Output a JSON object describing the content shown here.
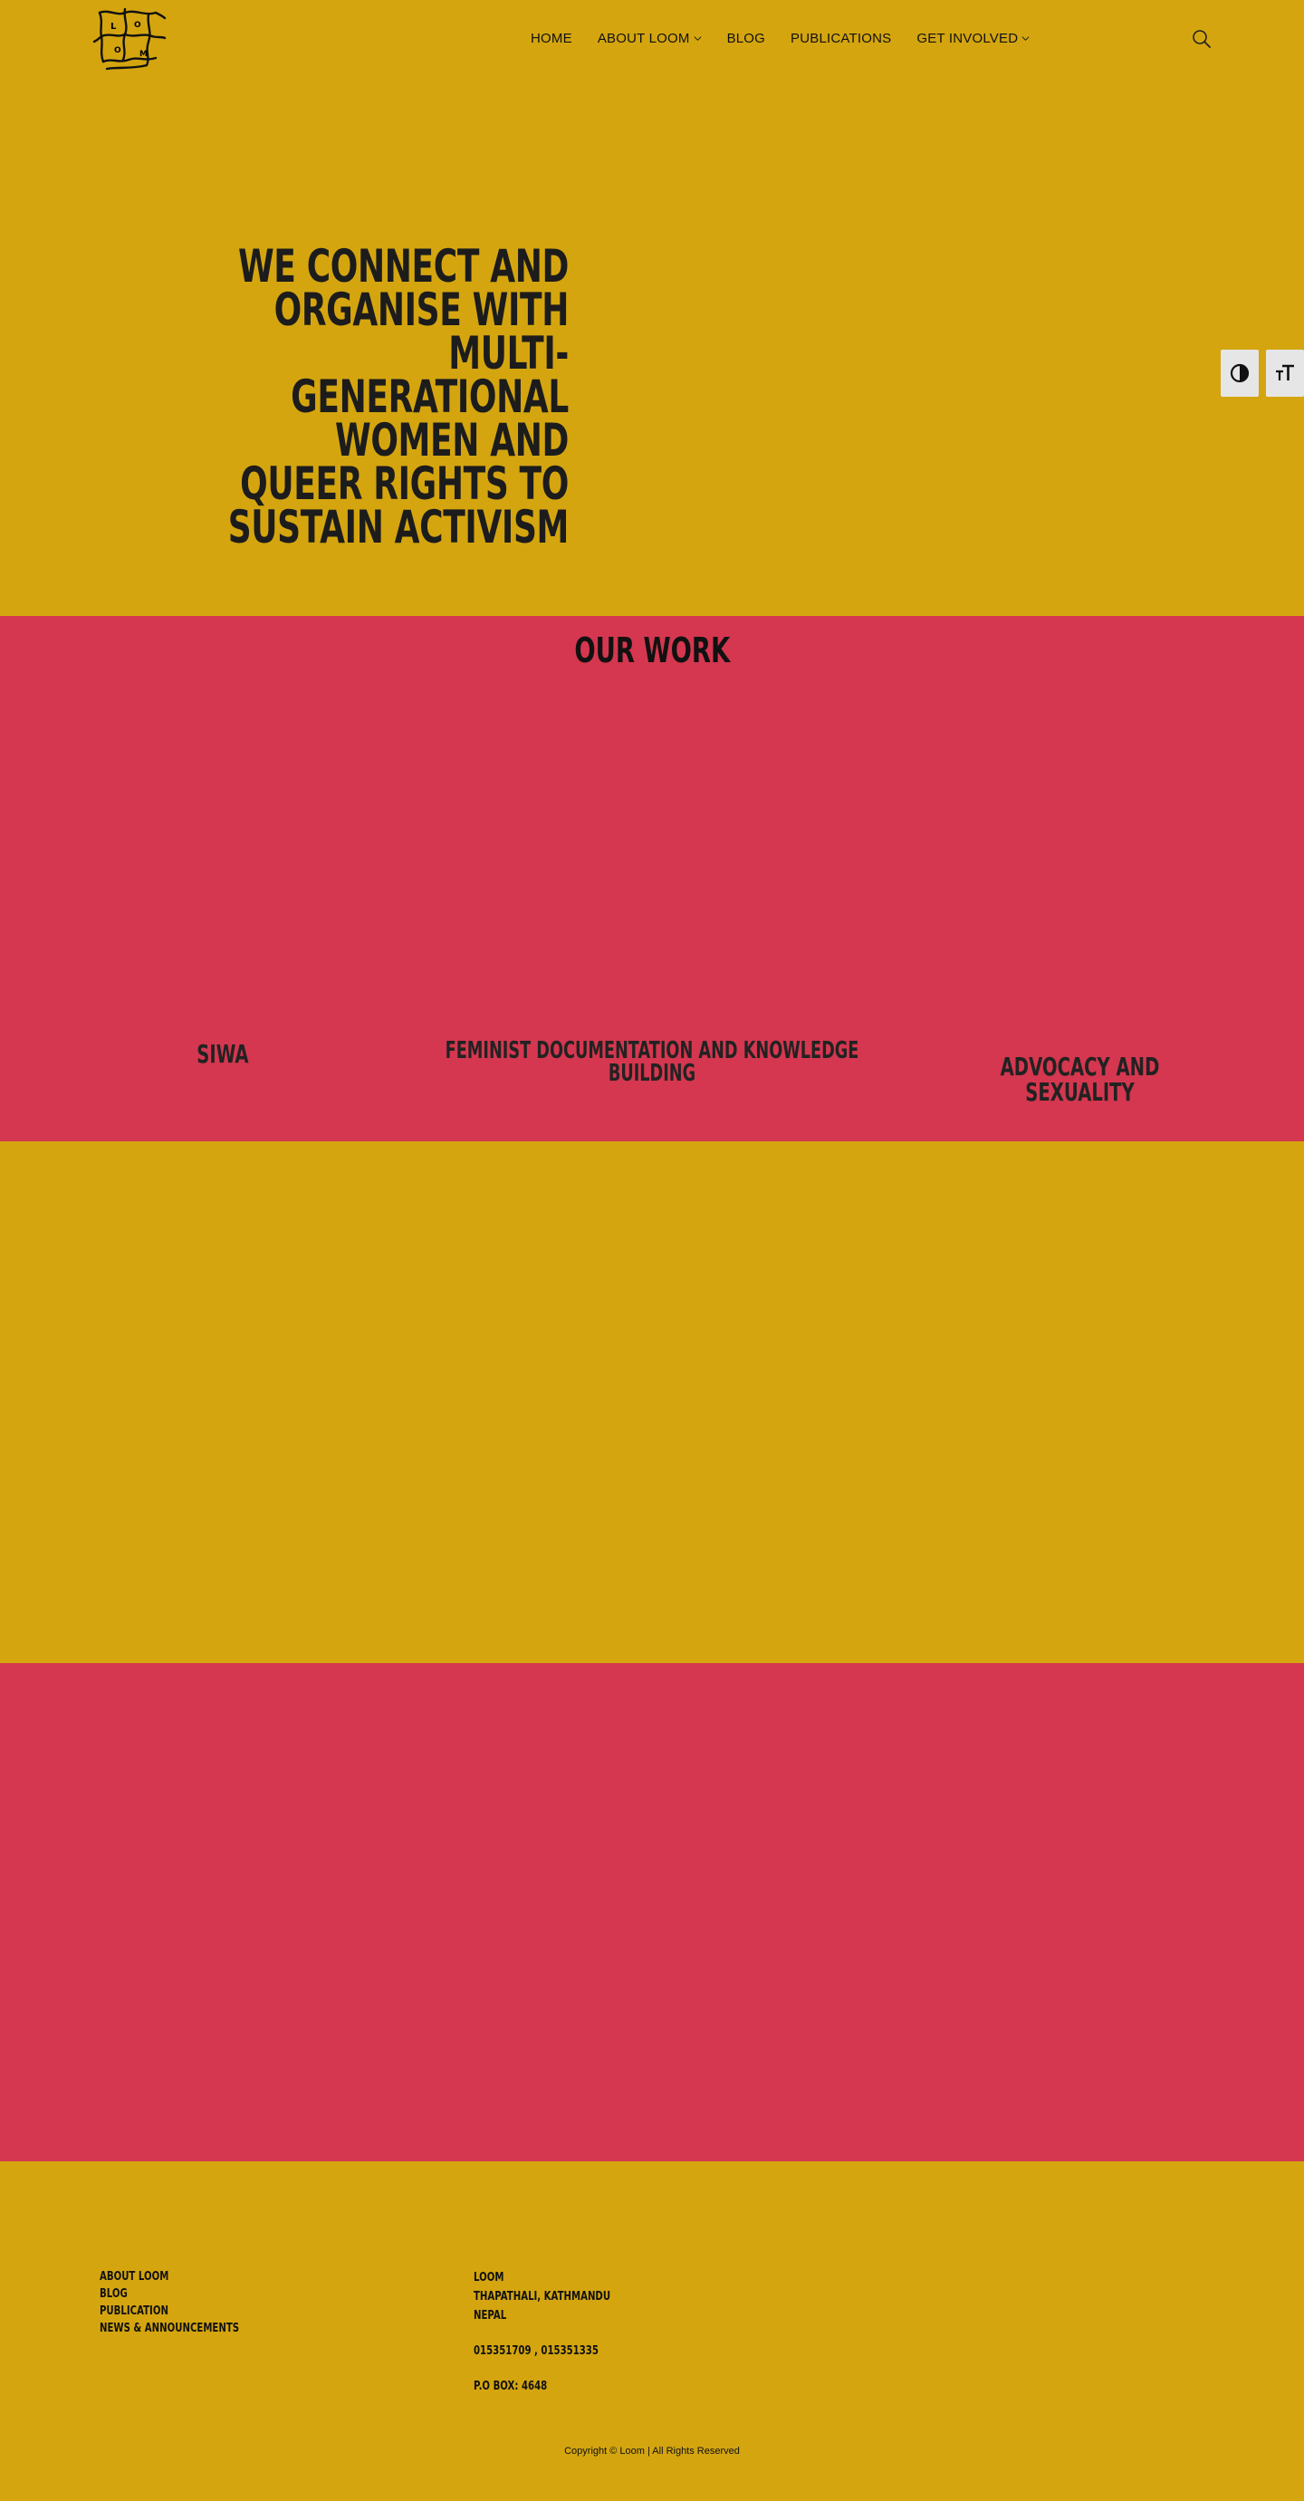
{
  "header": {
    "logo_name": "loom-logo",
    "logo_text": "लूम सँस्था",
    "nav": [
      {
        "label": "HOME",
        "has_dropdown": false
      },
      {
        "label": "ABOUT LOOM",
        "has_dropdown": true
      },
      {
        "label": "BLOG",
        "has_dropdown": false
      },
      {
        "label": "PUBLICATIONS",
        "has_dropdown": false
      },
      {
        "label": "GET INVOLVED",
        "has_dropdown": true
      }
    ],
    "search_icon": "search-icon"
  },
  "accessibility": {
    "contrast_icon": "contrast-icon",
    "font_size_icon": "font-size-icon"
  },
  "hero": {
    "headline": "WE CONNECT AND ORGANISE WITH MULTI- GENERATIONAL WOMEN AND QUEER RIGHTS TO SUSTAIN ACTIVISM"
  },
  "our_work": {
    "title": "OUR WORK",
    "items": [
      {
        "title": "SIWA"
      },
      {
        "title": "FEMINIST DOCUMENTATION AND KNOWLEDGE BUILDING"
      },
      {
        "title": "ADVOCACY AND SEXUALITY"
      }
    ]
  },
  "footer": {
    "links": [
      "ABOUT LOOM",
      "BLOG",
      "PUBLICATION",
      "NEWS & ANNOUNCEMENTS"
    ],
    "contact": {
      "name": "LOOM",
      "address1": "THAPATHALI, KATHMANDU",
      "address2": "NEPAL",
      "phone": "015351709 , 015351335",
      "pobox": "P.O BOX: 4648"
    },
    "copyright": "Copyright © Loom | All Rights Reserved"
  },
  "colors": {
    "yellow": "#d4a50f",
    "red": "#d4374f",
    "text": "#111111"
  }
}
